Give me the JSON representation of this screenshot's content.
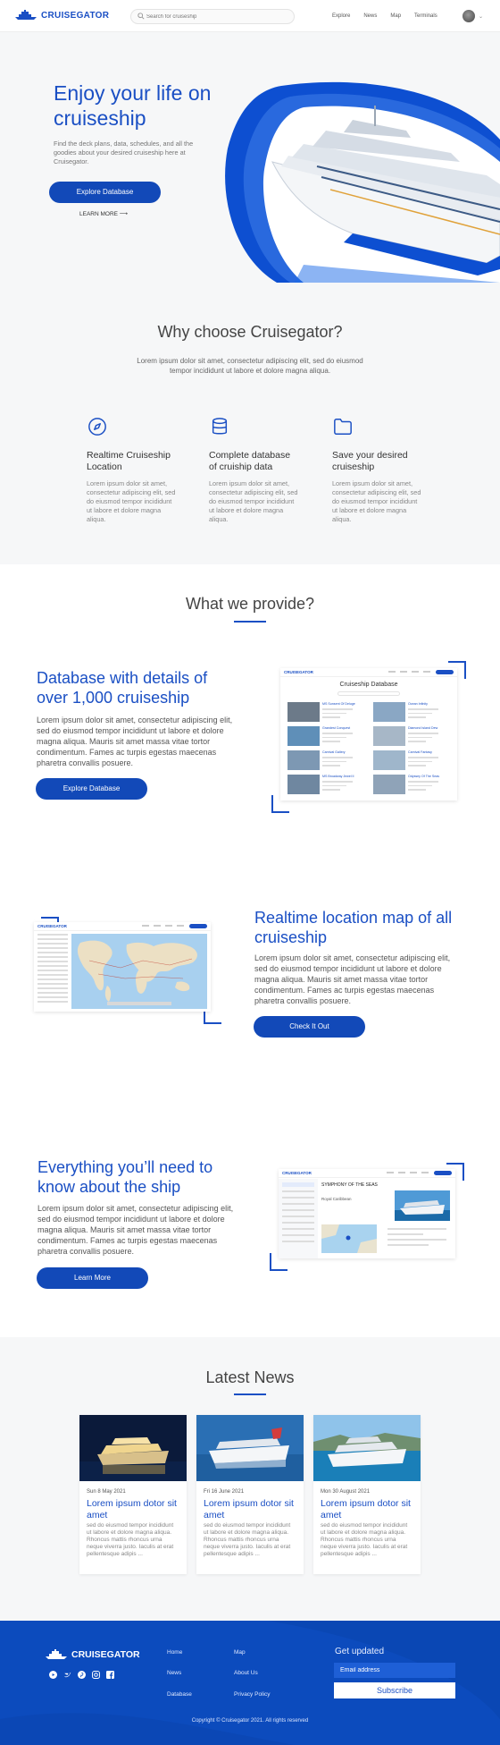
{
  "brand": {
    "name": "CRUISEGATOR",
    "accent": "#1a4fc4",
    "dark_accent": "#1249b8"
  },
  "nav": {
    "search_placeholder": "Search for cruiseship",
    "links": [
      "Explore",
      "News",
      "Map",
      "Terminals"
    ]
  },
  "hero": {
    "title": "Enjoy your life on cruiseship",
    "subtitle": "Find the deck plans, data, schedules, and all the goodies about your desired cruiseship here at Cruisegator.",
    "cta": "Explore Database",
    "link": "LEARN MORE ⟶"
  },
  "why": {
    "title": "Why choose Cruisegator?",
    "description": "Lorem ipsum dolor sit amet, consectetur adipiscing elit, sed do eiusmod tempor incididunt ut labore et dolore magna aliqua.",
    "features": [
      {
        "icon": "compass-icon",
        "title": "Realtime Cruiseship Location",
        "text": "Lorem ipsum dolor sit amet, consectetur adipiscing elit, sed do eiusmod tempor incididunt ut labore et dolore magna aliqua."
      },
      {
        "icon": "database-icon",
        "title": "Complete database of cruiship data",
        "text": "Lorem ipsum dolor sit amet, consectetur adipiscing elit, sed do eiusmod tempor incididunt ut labore et dolore magna aliqua."
      },
      {
        "icon": "folder-icon",
        "title": "Save your desired cruiseship",
        "text": "Lorem ipsum dolor sit amet, consectetur adipiscing elit, sed do eiusmod tempor incididunt ut labore et dolore magna aliqua."
      }
    ]
  },
  "provide": {
    "title": "What we provide?",
    "items": [
      {
        "title": "Database with details of over 1,000 cruiseship",
        "text": "Lorem ipsum dolor sit amet, consectetur adipiscing elit, sed do eiusmod tempor incididunt ut labore et dolore magna aliqua. Mauris sit amet massa vitae tortor condimentum. Fames ac turpis egestas maecenas pharetra convallis posuere.",
        "cta": "Explore Database"
      },
      {
        "title": "Realtime location map of all cruiseship",
        "text": "Lorem ipsum dolor sit amet, consectetur adipiscing elit, sed do eiusmod tempor incididunt ut labore et dolore magna aliqua. Mauris sit amet massa vitae tortor condimentum. Fames ac turpis egestas maecenas pharetra convallis posuere.",
        "cta": "Check It Out"
      },
      {
        "title": "Everything you’ll need to know about the ship",
        "text": "Lorem ipsum dolor sit amet, consectetur adipiscing elit, sed do eiusmod tempor incididunt ut labore et dolore magna aliqua. Mauris sit amet massa vitae tortor condimentum. Fames ac turpis egestas maecenas pharetra convallis posuere.",
        "cta": "Learn More"
      }
    ],
    "db_preview": {
      "title": "Cruiseship Database",
      "ships": [
        "MS Sunsent Of Deluge",
        "Ocean Infinity",
        "Grandest Conquest",
        "Diamond Island Dew",
        "Carnival Gallery",
        "Carnival Fantasy",
        "MS Broadway Jewel II",
        "Odyssey Of The Seas"
      ]
    },
    "detail_preview": {
      "ship": "SYMPHONY OF THE SEAS",
      "operator": "Royal Caribbean"
    }
  },
  "news": {
    "title": "Latest News",
    "cards": [
      {
        "date": "Sun 8 May 2021",
        "title": "Lorem ipsum dotor sit amet",
        "text": "sed do eiusmod tempor incididunt ut labore et dolore magna aliqua. Rhoncus mattis rhoncus urna neque viverra justo. Iaculis at erat pellentesque adipis ..."
      },
      {
        "date": "Fri 16 June 2021",
        "title": "Lorem ipsum dotor sit amet",
        "text": "sed do eiusmod tempor incididunt ut labore et dolore magna aliqua. Rhoncus mattis rhoncus urna neque viverra justo. Iaculis at erat pellentesque adipis ..."
      },
      {
        "date": "Mon 30 August 2021",
        "title": "Lorem ipsum dotor sit amet",
        "text": "sed do eiusmod tempor incididunt ut labore et dolore magna aliqua. Rhoncus mattis rhoncus urna neque viverra justo. Iaculis at erat pellentesque adipis ..."
      }
    ]
  },
  "footer": {
    "brand": "CRUISEGATOR",
    "social": [
      "youtube-icon",
      "twitter-icon",
      "pinterest-icon",
      "instagram-icon",
      "facebook-icon"
    ],
    "col1": [
      "Home",
      "News",
      "Database"
    ],
    "col2": [
      "Map",
      "About Us",
      "Privacy Policy"
    ],
    "newsletter_heading": "Get updated",
    "email_placeholder": "Email address",
    "subscribe": "Subscribe",
    "copyright": "Copyright © Cruisegator 2021. All rights reserved",
    "background": "#0c4bbd"
  }
}
